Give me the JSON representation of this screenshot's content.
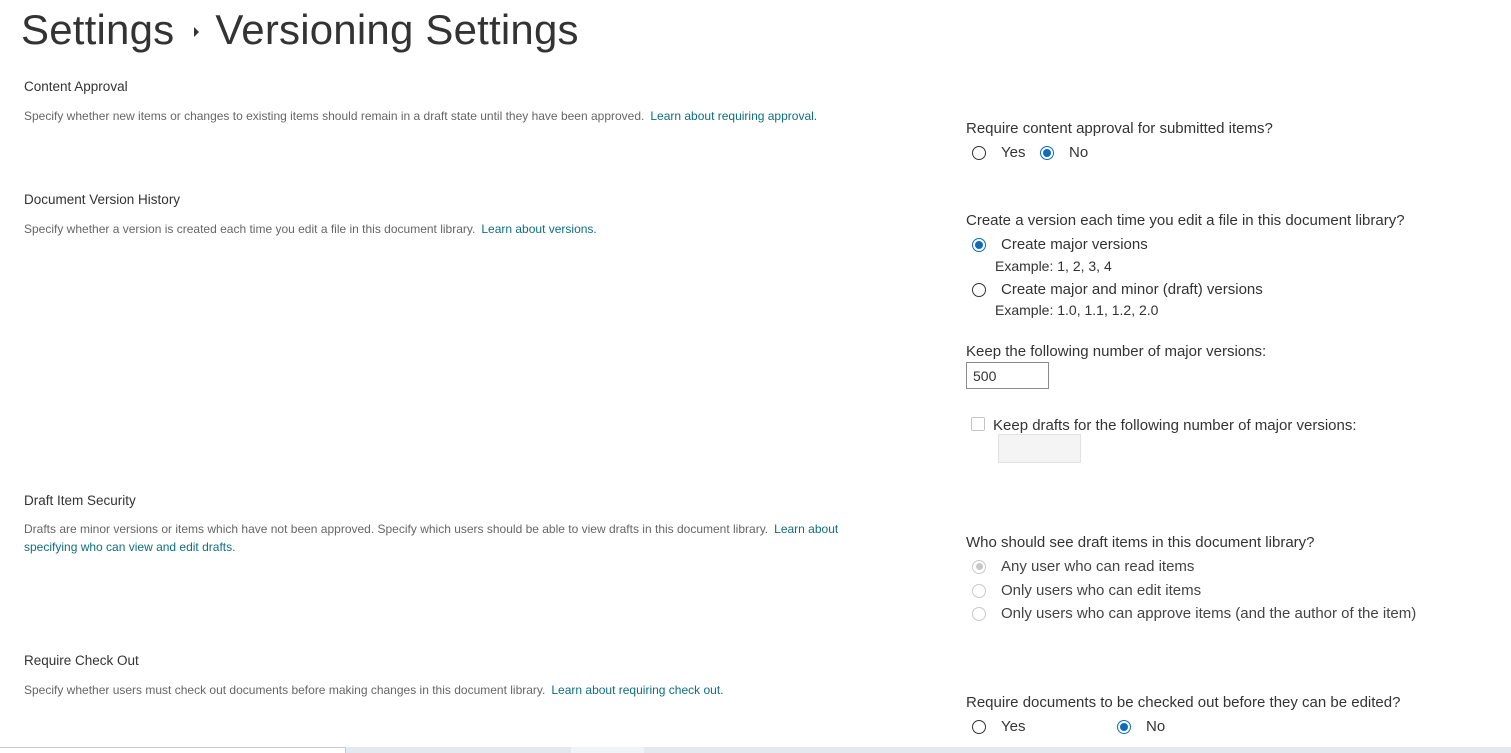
{
  "page": {
    "breadcrumb_root": "Settings",
    "title": "Versioning Settings"
  },
  "content_approval": {
    "heading": "Content Approval",
    "description": "Specify whether new items or changes to existing items should remain in a draft state until they have been approved.",
    "link": "Learn about requiring approval.",
    "question": "Require content approval for submitted items?",
    "options": [
      {
        "label": "Yes",
        "checked": false
      },
      {
        "label": "No",
        "checked": true
      }
    ]
  },
  "version_history": {
    "heading": "Document Version History",
    "description": "Specify whether a version is created each time you edit a file in this document library.",
    "link": "Learn about versions.",
    "question": "Create a version each time you edit a file in this document library?",
    "options": [
      {
        "label": "Create major versions",
        "example": "Example: 1, 2, 3, 4",
        "checked": true
      },
      {
        "label": "Create major and minor (draft) versions",
        "example": "Example: 1.0, 1.1, 1.2, 2.0",
        "checked": false
      }
    ],
    "major_limit_label": "Keep the following number of major versions:",
    "major_limit_value": "500",
    "drafts_limit_label": "Keep drafts for the following number of major versions:",
    "drafts_limit_checked": false,
    "drafts_limit_value": ""
  },
  "draft_security": {
    "heading": "Draft Item Security",
    "description": "Drafts are minor versions or items which have not been approved. Specify which users should be able to view drafts in this document library.",
    "link": "Learn about specifying who can view and edit drafts.",
    "question": "Who should see draft items in this document library?",
    "options": [
      {
        "label": "Any user who can read items",
        "checked": true,
        "disabled": true
      },
      {
        "label": "Only users who can edit items",
        "checked": false,
        "disabled": true
      },
      {
        "label": "Only users who can approve items (and the author of the item)",
        "checked": false,
        "disabled": true
      }
    ]
  },
  "check_out": {
    "heading": "Require Check Out",
    "description": "Specify whether users must check out documents before making changes in this document library.",
    "link": "Learn about requiring check out.",
    "question": "Require documents to be checked out before they can be edited?",
    "options": [
      {
        "label": "Yes",
        "checked": false
      },
      {
        "label": "No",
        "checked": true
      }
    ]
  },
  "colors": {
    "accent": "#0f6cbd",
    "link": "#0f6e7e",
    "disabled": "#c8c8c8"
  }
}
